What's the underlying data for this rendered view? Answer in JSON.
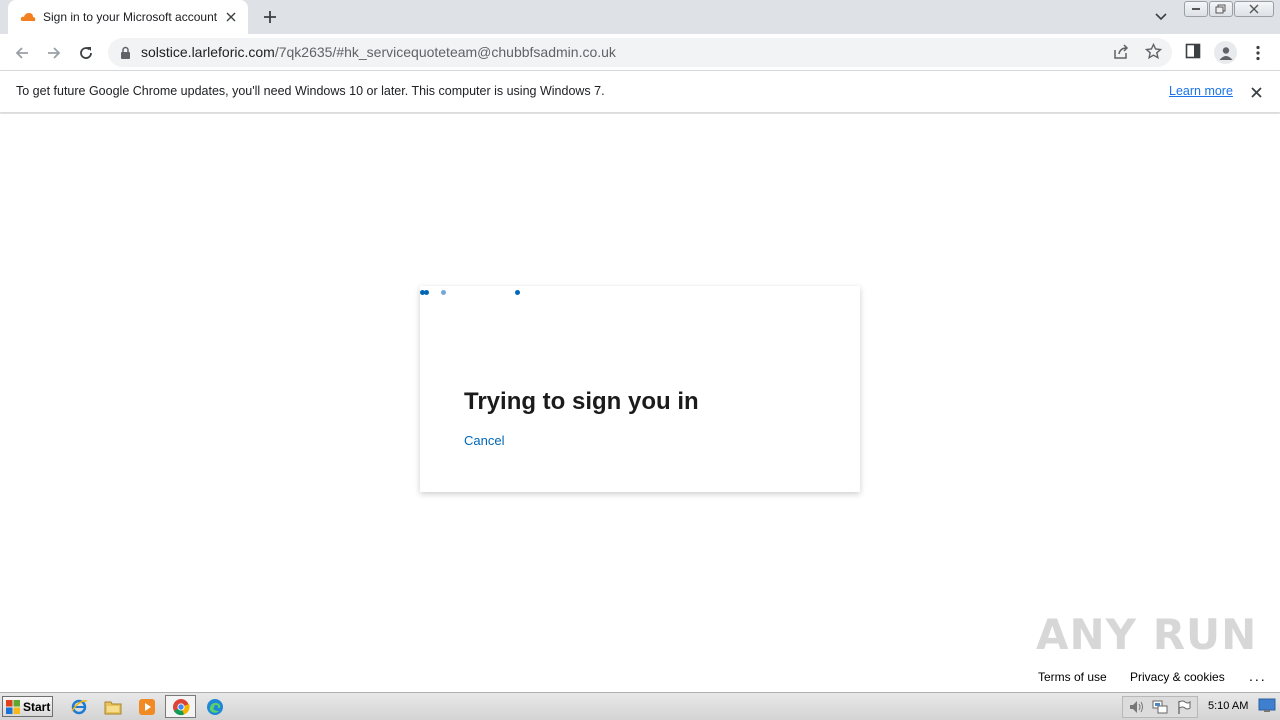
{
  "browser": {
    "tab": {
      "title": "Sign in to your Microsoft account",
      "favicon": "cloudflare-cloud-icon"
    },
    "address": {
      "host": "solstice.larleforic.com",
      "path": "/7qk2635/#hk_servicequoteteam@chubbfsadmin.co.uk"
    },
    "infobar": {
      "message": "To get future Google Chrome updates, you'll need Windows 10 or later. This computer is using Windows 7.",
      "link": "Learn more"
    }
  },
  "page": {
    "heading": "Trying to sign you in",
    "cancel_label": "Cancel",
    "footer": {
      "terms": "Terms of use",
      "privacy": "Privacy & cookies",
      "more": "..."
    },
    "watermark": "ANY RUN"
  },
  "taskbar": {
    "start_label": "Start",
    "pinned": [
      "internet-explorer-icon",
      "file-explorer-icon",
      "media-player-icon",
      "chrome-icon",
      "edge-icon"
    ],
    "clock": "5:10 AM"
  },
  "colors": {
    "accent": "#0067b8",
    "chrome_frame": "#dee1e6",
    "link_blue": "#1a73e8"
  }
}
